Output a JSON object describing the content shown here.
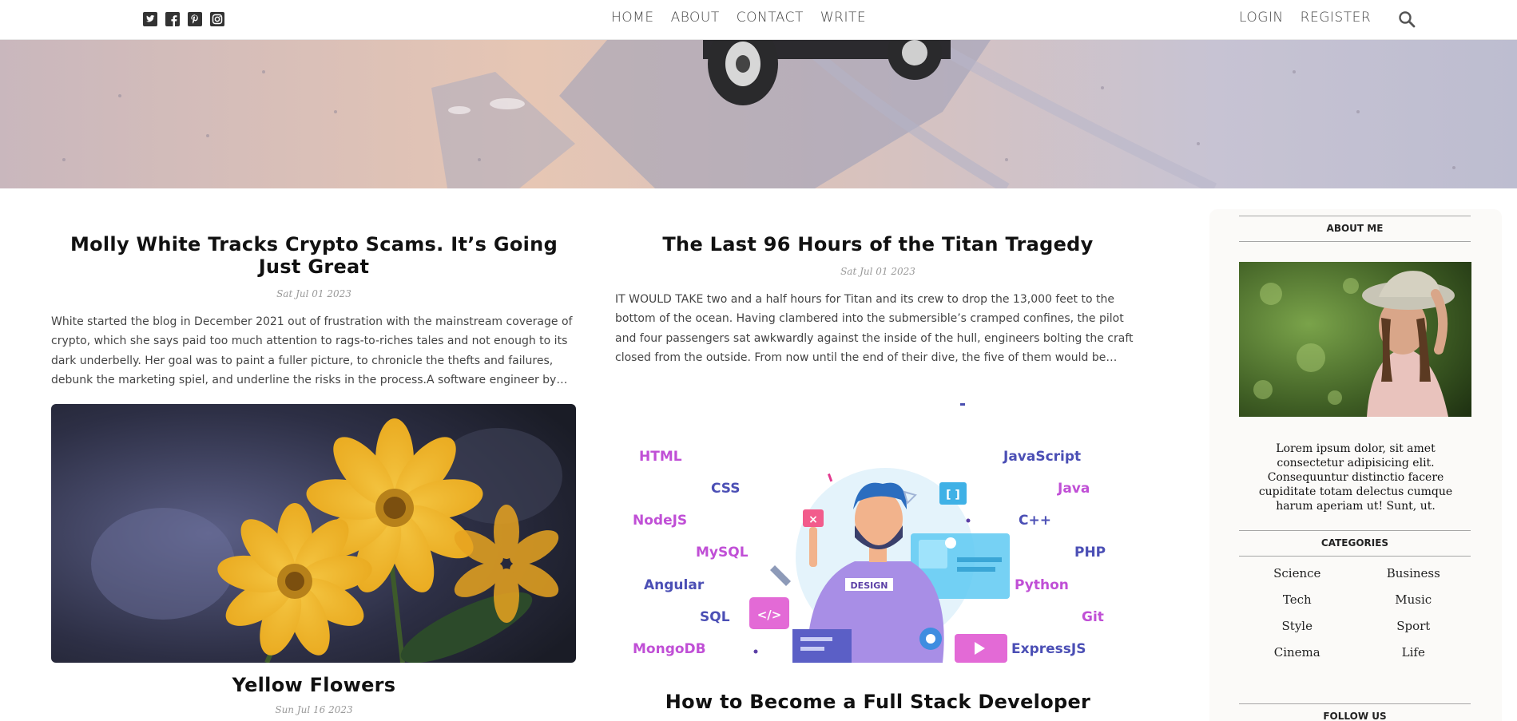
{
  "header": {
    "social": [
      "twitter-icon",
      "facebook-icon",
      "pinterest-icon",
      "instagram-icon"
    ],
    "nav": [
      "HOME",
      "ABOUT",
      "CONTACT",
      "WRITE"
    ],
    "auth": [
      "LOGIN",
      "REGISTER"
    ],
    "search_icon": "search-icon"
  },
  "posts": [
    {
      "title": "Molly White Tracks Crypto Scams. It’s Going Just Great",
      "date": "Sat Jul 01 2023",
      "desc": "White started the blog in December 2021 out of frustration with the mainstream coverage of crypto, which she says paid too much attention to rags-to-riches tales and not enough to its dark underbelly. Her goal was to paint a fuller picture, to chronicle the thefts and failures, debunk the marketing spiel, and underline the risks in the process.A software engineer by trade, White code…"
    },
    {
      "title": "The Last 96 Hours of the Titan Tragedy",
      "date": "Sat Jul 01 2023",
      "desc": "IT WOULD TAKE two and a half hours for Titan and its crew to drop the 13,000 feet to the bottom of the ocean. Having clambered into the submersible’s cramped confines, the pilot and four passengers sat awkwardly against the inside of the hull, engineers bolting the craft closed from the outside. From now until the end of their dive, the five of them would be encapsulated,…"
    },
    {
      "title": "Yellow Flowers",
      "date": "Sun Jul 16 2023"
    },
    {
      "title": "How to Become a Full Stack Developer",
      "illustration": {
        "tags_left": [
          "HTML",
          "CSS",
          "NodeJS",
          "MySQL",
          "Angular",
          "SQL",
          "MongoDB"
        ],
        "tags_right": [
          "JavaScript",
          "Java",
          "C++",
          "PHP",
          "Python",
          "Git",
          "ExpressJS"
        ],
        "shirt_text": "DESIGN",
        "code_symbol": "</>",
        "bracket_symbol": "[ ]"
      }
    }
  ],
  "sidebar": {
    "about_title": "ABOUT ME",
    "about_text": "Lorem ipsum dolor, sit amet consectetur adipisicing elit. Consequuntur distinctio facere cupiditate totam delectus cumque harum aperiam ut! Sunt, ut.",
    "categories_title": "CATEGORIES",
    "categories": [
      "Science",
      "Business",
      "Tech",
      "Music",
      "Style",
      "Sport",
      "Cinema",
      "Life"
    ],
    "follow_title": "FOLLOW US"
  }
}
